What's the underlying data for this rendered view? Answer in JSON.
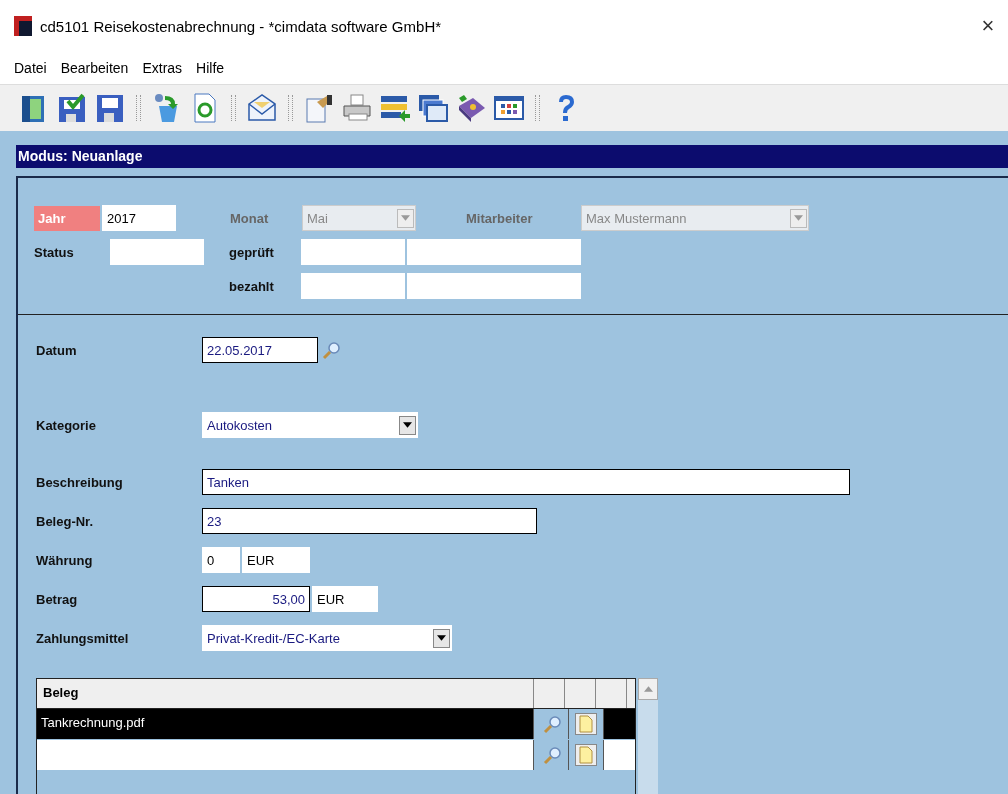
{
  "window": {
    "title": "cd5101 Reisekostenabrechnung - *cimdata software GmbH*",
    "close": "×"
  },
  "menu": [
    {
      "label": "Datei"
    },
    {
      "label": "Bearbeiten"
    },
    {
      "label": "Extras"
    },
    {
      "label": "Hilfe"
    }
  ],
  "toolbar": [
    {
      "kind": "door"
    },
    {
      "kind": "save-check"
    },
    {
      "kind": "save"
    },
    {
      "kind": "sep"
    },
    {
      "kind": "recycle"
    },
    {
      "kind": "refresh"
    },
    {
      "kind": "sep"
    },
    {
      "kind": "mail"
    },
    {
      "kind": "sep"
    },
    {
      "kind": "notepad"
    },
    {
      "kind": "printer"
    },
    {
      "kind": "list"
    },
    {
      "kind": "windows"
    },
    {
      "kind": "book"
    },
    {
      "kind": "grid"
    },
    {
      "kind": "sep"
    },
    {
      "kind": "help"
    }
  ],
  "mode_bar": "Modus: Neuanlage",
  "header": {
    "jahr": {
      "label": "Jahr",
      "value": "2017"
    },
    "monat": {
      "label": "Monat",
      "value": "Mai",
      "disabled": true
    },
    "mitarbeiter": {
      "label": "Mitarbeiter",
      "value": "Max Mustermann",
      "disabled": true
    },
    "status": {
      "label": "Status"
    },
    "geprueft": {
      "label": "geprüft"
    },
    "bezahlt": {
      "label": "bezahlt"
    }
  },
  "form": {
    "datum": {
      "label": "Datum",
      "value": "22.05.2017"
    },
    "kategorie": {
      "label": "Kategorie",
      "value": "Autokosten"
    },
    "beschreibung": {
      "label": "Beschreibung",
      "value": "Tanken"
    },
    "beleg_nr": {
      "label": "Beleg-Nr.",
      "value": "23"
    },
    "waehrung": {
      "label": "Währung",
      "value": "0",
      "currency": "EUR"
    },
    "betrag": {
      "label": "Betrag",
      "value": "53,00",
      "currency": "EUR"
    },
    "zahlungsmittel": {
      "label": "Zahlungsmittel",
      "value": "Privat-Kredit-/EC-Karte"
    }
  },
  "table": {
    "columns": [
      "Beleg"
    ],
    "rows": [
      {
        "beleg": "Tankrechnung.pdf",
        "selected": true
      },
      {
        "beleg": "",
        "selected": false
      }
    ]
  }
}
